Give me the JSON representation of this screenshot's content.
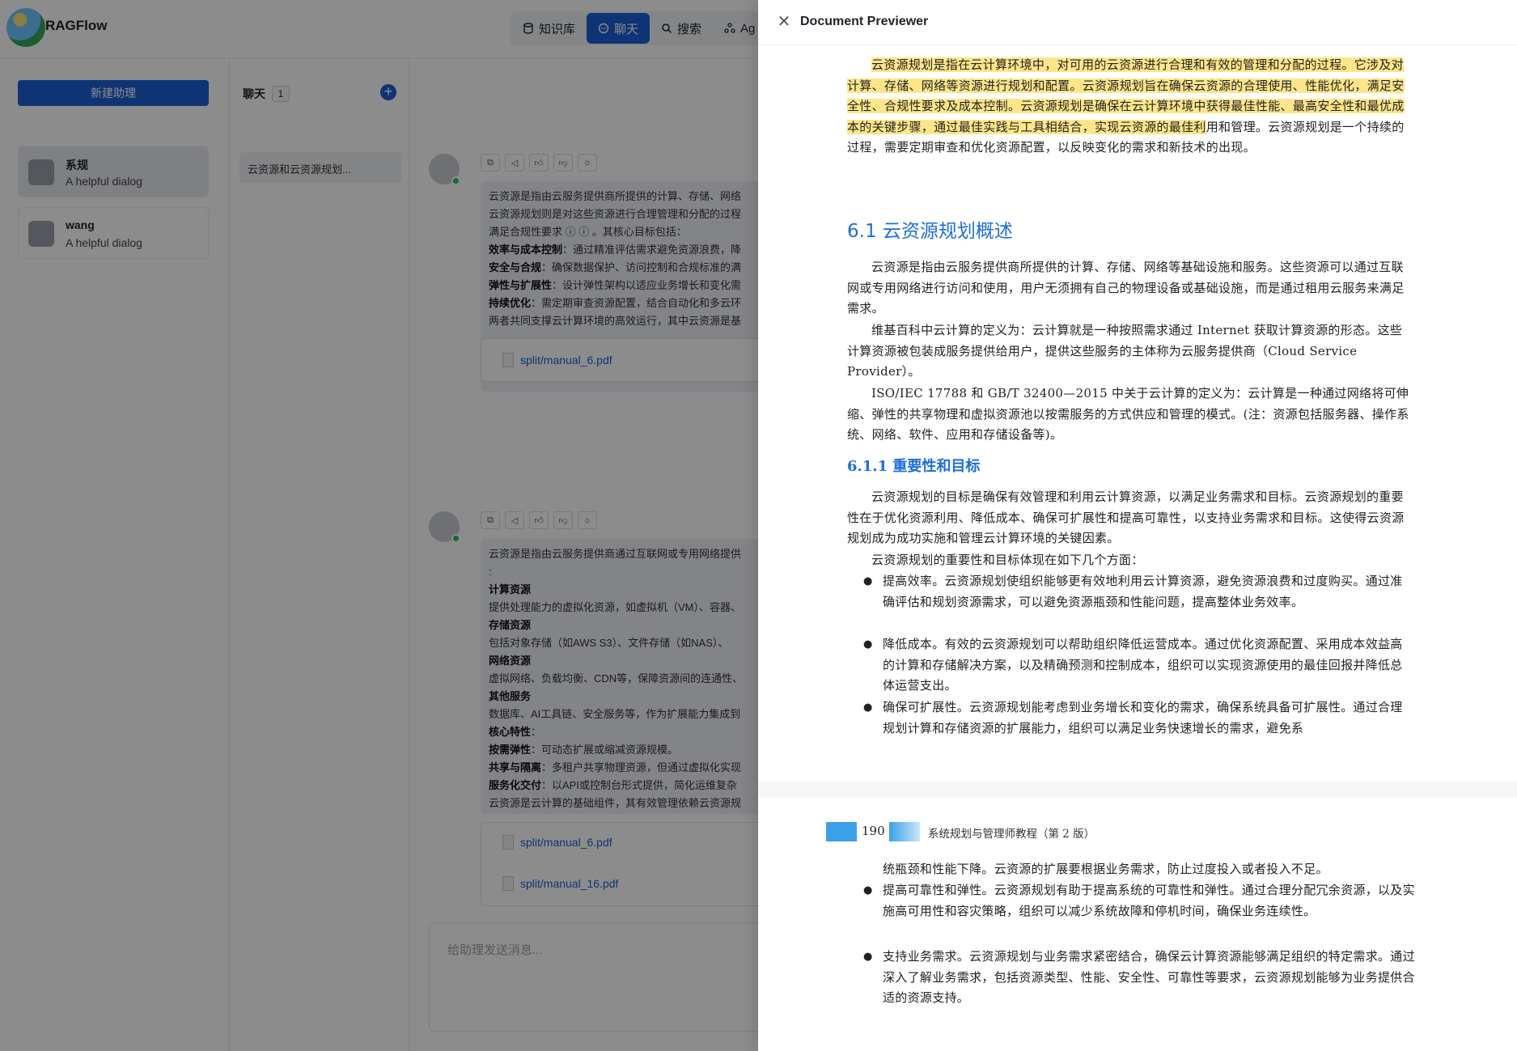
{
  "app": {
    "brand": "RAGFlow",
    "nav": [
      {
        "label": "知识库",
        "icon": "database-icon"
      },
      {
        "label": "聊天",
        "icon": "chat-icon",
        "active": true
      },
      {
        "label": "搜索",
        "icon": "search-icon"
      },
      {
        "label": "Ag",
        "icon": "agent-icon"
      }
    ]
  },
  "assistants": {
    "new_button": "新建助理",
    "items": [
      {
        "name": "系规",
        "desc": "A helpful dialog",
        "selected": true
      },
      {
        "name": "wang",
        "desc": "A helpful dialog",
        "selected": false
      }
    ]
  },
  "chats": {
    "title": "聊天",
    "count": "1",
    "add_icon": "plus-icon",
    "items": [
      {
        "title": "云资源和云资源规划..."
      }
    ]
  },
  "messages": [
    {
      "tools": [
        "copy-icon",
        "speaker-icon",
        "thumbs-up-icon",
        "thumbs-down-icon",
        "bulb-icon"
      ],
      "lines": [
        {
          "b": "",
          "t": "云资源是指由云服务提供商所提供的计算、存储、网络"
        },
        {
          "b": "",
          "t": "云资源规划则是对这些资源进行合理管理和分配的过程"
        },
        {
          "b": "",
          "t": "满足合规性要求 ⓘ ⓘ 。其核心目标包括："
        },
        {
          "b": "效率与成本控制",
          "t": "：通过精准评估需求避免资源浪费，降"
        },
        {
          "b": "安全与合规",
          "t": "：确保数据保护、访问控制和合规标准的满"
        },
        {
          "b": "弹性与扩展性",
          "t": "：设计弹性架构以适应业务增长和变化需"
        },
        {
          "b": "持续优化",
          "t": "：需定期审查资源配置，结合自动化和多云环"
        },
        {
          "b": "",
          "t": "两者共同支撑云计算环境的高效运行，其中云资源是基"
        }
      ],
      "refs": [
        "split/manual_6.pdf"
      ]
    },
    {
      "tools": [
        "copy-icon",
        "speaker-icon",
        "thumbs-up-icon",
        "thumbs-down-icon",
        "bulb-icon"
      ],
      "lines": [
        {
          "b": "",
          "t": "云资源是指由云服务提供商通过互联网或专用网络提供"
        },
        {
          "b": "",
          "t": ":"
        },
        {
          "b": "计算资源",
          "t": ""
        },
        {
          "b": "",
          "t": "提供处理能力的虚拟化资源，如虚拟机（VM）、容器、"
        },
        {
          "b": "存储资源",
          "t": ""
        },
        {
          "b": "",
          "t": "包括对象存储（如AWS S3）、文件存储（如NAS）、"
        },
        {
          "b": "网络资源",
          "t": ""
        },
        {
          "b": "",
          "t": "虚拟网络、负载均衡、CDN等，保障资源间的连通性、"
        },
        {
          "b": "其他服务",
          "t": ""
        },
        {
          "b": "",
          "t": "数据库、AI工具链、安全服务等，作为扩展能力集成到"
        },
        {
          "b": "核心特性",
          "t": "："
        },
        {
          "b": "按需弹性",
          "t": "：可动态扩展或缩减资源规模。"
        },
        {
          "b": "共享与隔离",
          "t": "：多租户共享物理资源，但通过虚拟化实现"
        },
        {
          "b": "服务化交付",
          "t": "：以API或控制台形式提供，简化运维复杂"
        },
        {
          "b": "",
          "t": "云资源是云计算的基础组件，其有效管理依赖云资源规"
        }
      ],
      "refs": [
        "split/manual_6.pdf",
        "split/manual_16.pdf"
      ]
    }
  ],
  "composer": {
    "placeholder": "给助理发送消息..."
  },
  "previewer": {
    "title": "Document Previewer",
    "page1": {
      "p0": "云资源规划是指在云计算环境中，对可用的云资源进行合理和有效的管理和分配的过程。它涉及对计算、存储、网络等资源进行规划和配置。云资源规划旨在确保云资源的合理使用、性能优化，满足安全性、合规性要求及成本控制。云资源规划是确保在云计算环境中获得最佳性能、最高安全性和最优成本的关键步骤，通过最佳实践与工具相结合，实现云资源的最佳利",
      "p0b": "用和管理。云资源规划是一个持续的过程，需要定期审查和优化资源配置，以反映变化的需求和新技术的出现。",
      "h61": "6.1   云资源规划概述",
      "p1": "云资源是指由云服务提供商所提供的计算、存储、网络等基础设施和服务。这些资源可以通过互联网或专用网络进行访问和使用，用户无须拥有自己的物理设备或基础设施，而是通过租用云服务来满足需求。",
      "p2": "维基百科中云计算的定义为：云计算就是一种按照需求通过 Internet 获取计算资源的形态。这些计算资源被包装成服务提供给用户，提供这些服务的主体称为云服务提供商（Cloud Service Provider）。",
      "p3": "ISO/IEC 17788 和 GB/T 32400—2015 中关于云计算的定义为：云计算是一种通过网络将可伸缩、弹性的共享物理和虚拟资源池以按需服务的方式供应和管理的模式。(注：资源包括服务器、操作系统、网络、软件、应用和存储设备等)。",
      "h611": "6.1.1   重要性和目标",
      "p4": "云资源规划的目标是确保有效管理和利用云计算资源，以满足业务需求和目标。云资源规划的重要性在于优化资源利用、降低成本、确保可扩展性和提高可靠性，以支持业务需求和目标。这使得云资源规划成为成功实施和管理云计算环境的关键因素。",
      "p5": "云资源规划的重要性和目标体现在如下几个方面：",
      "bullets": [
        "提高效率。云资源规划使组织能够更有效地利用云计算资源，避免资源浪费和过度购买。通过准确评估和规划资源需求，可以避免资源瓶颈和性能问题，提高整体业务效率。",
        "降低成本。有效的云资源规划可以帮助组织降低运营成本。通过优化资源配置、采用成本效益高的计算和存储解决方案，以及精确预测和控制成本，组织可以实现资源使用的最佳回报并降低总体运营支出。",
        "确保可扩展性。云资源规划能考虑到业务增长和变化的需求，确保系统具备可扩展性。通过合理规划计算和存储资源的扩展能力，组织可以满足业务快速增长的需求，避免系"
      ]
    },
    "page2": {
      "page_number": "190",
      "book_title": "系统规划与管理师教程（第 2 版）",
      "cont": "统瓶颈和性能下降。云资源的扩展要根据业务需求，防止过度投入或者投入不足。",
      "bullets": [
        "提高可靠性和弹性。云资源规划有助于提高系统的可靠性和弹性。通过合理分配冗余资源，以及实施高可用性和容灾策略，组织可以减少系统故障和停机时间，确保业务连续性。",
        "支持业务需求。云资源规划与业务需求紧密结合，确保云计算资源能够满足组织的特定需求。通过深入了解业务需求，包括资源类型、性能、安全性、可靠性等要求，云资源规划能够为业务提供合适的资源支持。"
      ]
    }
  },
  "colors": {
    "accent": "#1d5fd6",
    "highlight": "#fde68a",
    "heading": "#1d6fd6"
  }
}
